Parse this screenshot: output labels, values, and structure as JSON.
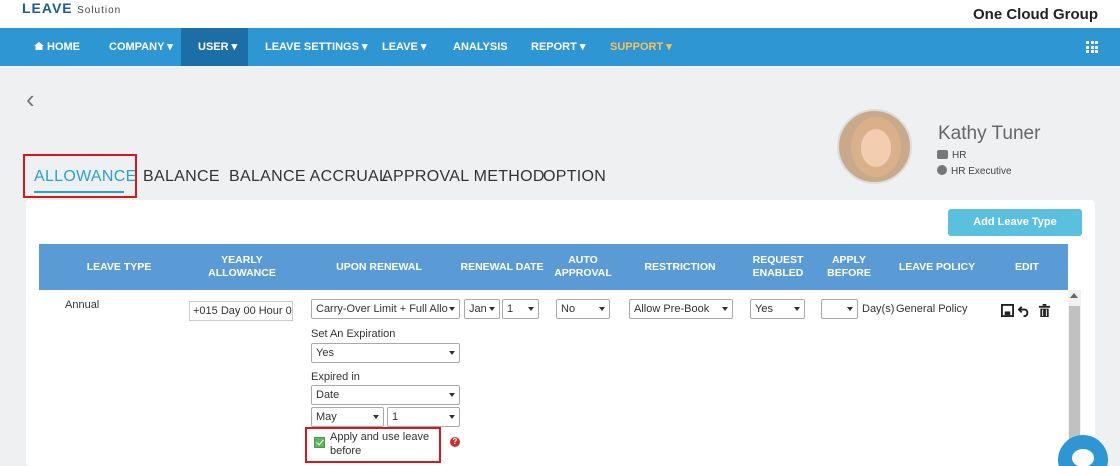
{
  "logo": {
    "main": "LEAVE",
    "sub": "Solution"
  },
  "company": "One Cloud Group",
  "nav": [
    {
      "label": "HOME",
      "icon": "home-icon"
    },
    {
      "label": "COMPANY ▾"
    },
    {
      "label": "USER ▾",
      "active": true
    },
    {
      "label": "LEAVE SETTINGS ▾"
    },
    {
      "label": "LEAVE ▾"
    },
    {
      "label": "ANALYSIS"
    },
    {
      "label": "REPORT ▾"
    },
    {
      "label": "SUPPORT ▾",
      "color": "#f7c25a"
    }
  ],
  "tabs": [
    "ALLOWANCE",
    "BALANCE",
    "BALANCE ACCRUAL",
    "APPROVAL METHOD",
    "OPTION"
  ],
  "profile": {
    "name": "Kathy Tuner",
    "department": "HR",
    "position": "HR Executive"
  },
  "add_button": "Add Leave Type",
  "table": {
    "headers": [
      "LEAVE TYPE",
      "YEARLY ALLOWANCE",
      "UPON RENEWAL",
      "RENEWAL DATE",
      "AUTO APPROVAL",
      "RESTRICTION",
      "REQUEST ENABLED",
      "APPLY BEFORE",
      "LEAVE POLICY",
      "EDIT"
    ],
    "row": {
      "leave_type": "Annual",
      "yearly_allowance": "+015 Day 00 Hour 0",
      "upon_renewal": "Carry-Over Limit + Full Allo",
      "renewal_month": "Jan",
      "renewal_day": "1",
      "auto_approval": "No",
      "restriction": "Allow Pre-Book",
      "request_enabled": "Yes",
      "apply_before": "",
      "apply_before_unit": "Day(s)",
      "leave_policy": "General Policy",
      "set_expiration_label": "Set An Expiration",
      "set_expiration": "Yes",
      "expired_in_label": "Expired in",
      "expired_in": "Date",
      "expired_month": "May",
      "expired_day": "1",
      "apply_use_leave_before": "Apply and use leave before",
      "apply_use_leave_checked": true,
      "help_glyph": "?"
    }
  },
  "colors": {
    "nav": "#2d96d3",
    "nav_active": "#1c6ea6",
    "table_header": "#5a9bd5",
    "accent": "#29a1d6",
    "highlight": "#d5181e"
  }
}
